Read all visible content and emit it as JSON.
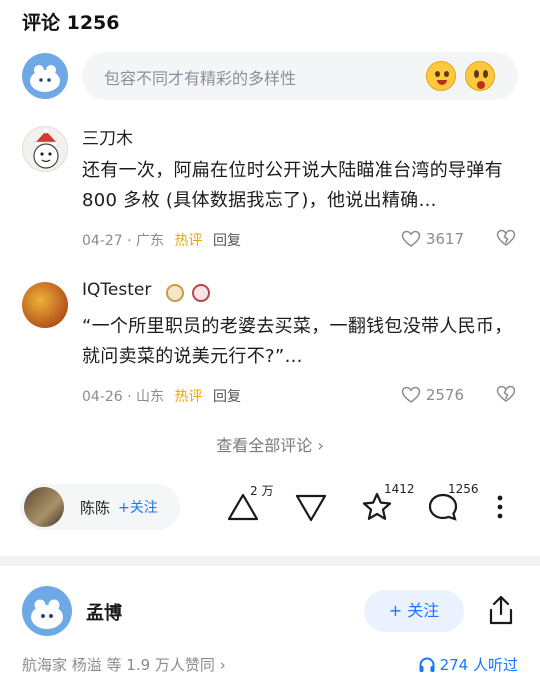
{
  "header": {
    "title": "评论 1256"
  },
  "comment_input": {
    "placeholder": "包容不同才有精彩的多样性"
  },
  "comments": [
    {
      "username": "三刀木",
      "text": "还有一次，阿扁在位时公开说大陆瞄准台湾的导弹有 800 多枚 (具体数据我忘了)，他说出精确…",
      "date": "04-27",
      "location": "广东",
      "hot_label": "热评",
      "reply_label": "回复",
      "likes": "3617"
    },
    {
      "username": "IQTester",
      "text": "“一个所里职员的老婆去买菜，一翻钱包没带人民币，就问卖菜的说美元行不?”…",
      "date": "04-26",
      "location": "山东",
      "hot_label": "热评",
      "reply_label": "回复",
      "likes": "2576"
    }
  ],
  "view_all": {
    "label": "查看全部评论 ›"
  },
  "action_bar": {
    "author_name": "陈陈",
    "follow_label": "+关注",
    "upvote_count": "2 万",
    "favorite_count": "1412",
    "comment_count": "1256"
  },
  "answer_author": {
    "name": "孟博",
    "follow_label": "+ 关注",
    "approvals": "航海家 杨溢 等 1.9 万人赞同 ›",
    "listens": "274 人听过"
  },
  "colors": {
    "accent": "#1677ff",
    "hot": "#f0a500",
    "muted": "#8c8c8c"
  }
}
